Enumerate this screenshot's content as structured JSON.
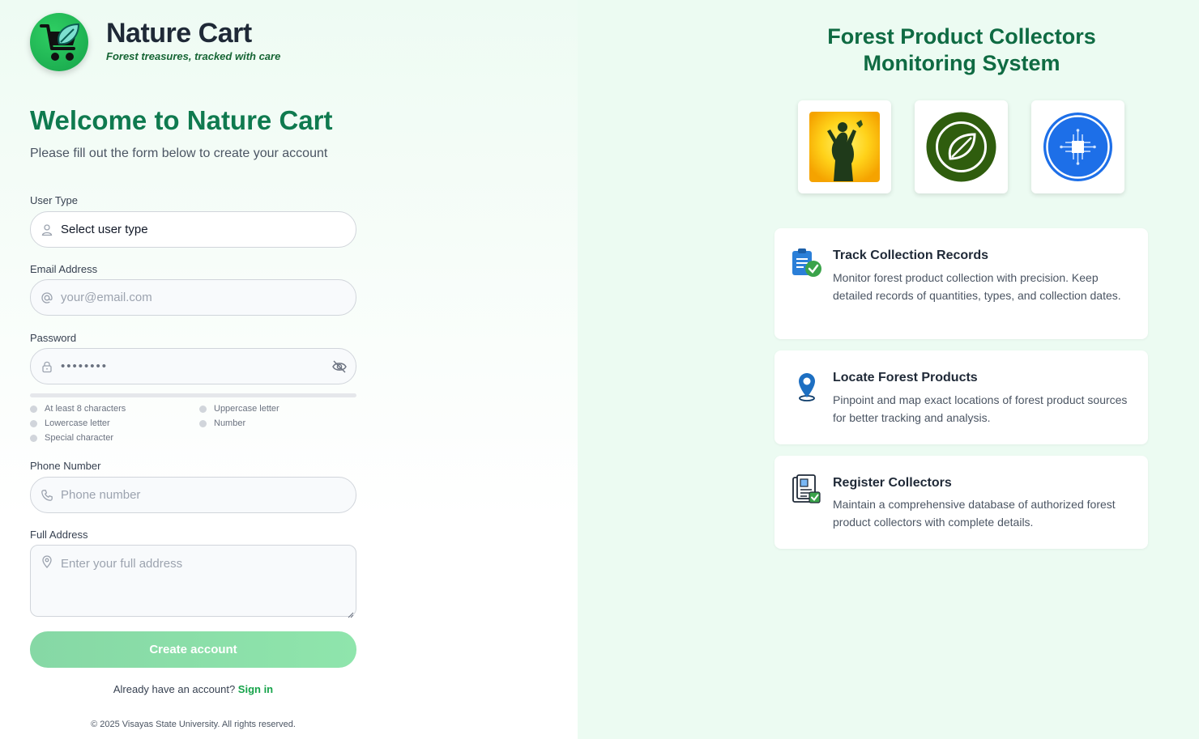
{
  "brand": {
    "name": "Nature Cart",
    "tagline": "Forest treasures, tracked with care"
  },
  "form": {
    "heading": "Welcome to Nature Cart",
    "subtitle": "Please fill out the form below to create your account",
    "user_type": {
      "label": "User Type",
      "value": "Select user type"
    },
    "email": {
      "label": "Email Address",
      "placeholder": "your@email.com"
    },
    "password": {
      "label": "Password",
      "value": "••••••••",
      "requirements": [
        "At least 8 characters",
        "Uppercase letter",
        "Lowercase letter",
        "Number",
        "Special character"
      ]
    },
    "phone": {
      "label": "Phone Number",
      "placeholder": "Phone number"
    },
    "address": {
      "label": "Full Address",
      "placeholder": "Enter your full address"
    },
    "submit_label": "Create account",
    "signin_prompt": "Already have an account?",
    "signin_link": "Sign in",
    "copyright": "© 2025 Visayas State University. All rights reserved."
  },
  "panel": {
    "title_line1": "Forest Product Collectors",
    "title_line2": "Monitoring System",
    "features": [
      {
        "title": "Track Collection Records",
        "description": "Monitor forest product collection with precision. Keep detailed records of quantities, types, and collection dates.",
        "icon": "clipboard-check-icon"
      },
      {
        "title": "Locate Forest Products",
        "description": "Pinpoint and map exact locations of forest product sources for better tracking and analysis.",
        "icon": "map-pin-icon"
      },
      {
        "title": "Register Collectors",
        "description": "Maintain a comprehensive database of authorized forest product collectors with complete details.",
        "icon": "id-document-check-icon"
      }
    ]
  },
  "colors": {
    "brand_green": "#0f7a4f",
    "accent_green": "#16a34a",
    "button_green": "#8fe5ac",
    "panel_bg": "#ecfbf2"
  }
}
